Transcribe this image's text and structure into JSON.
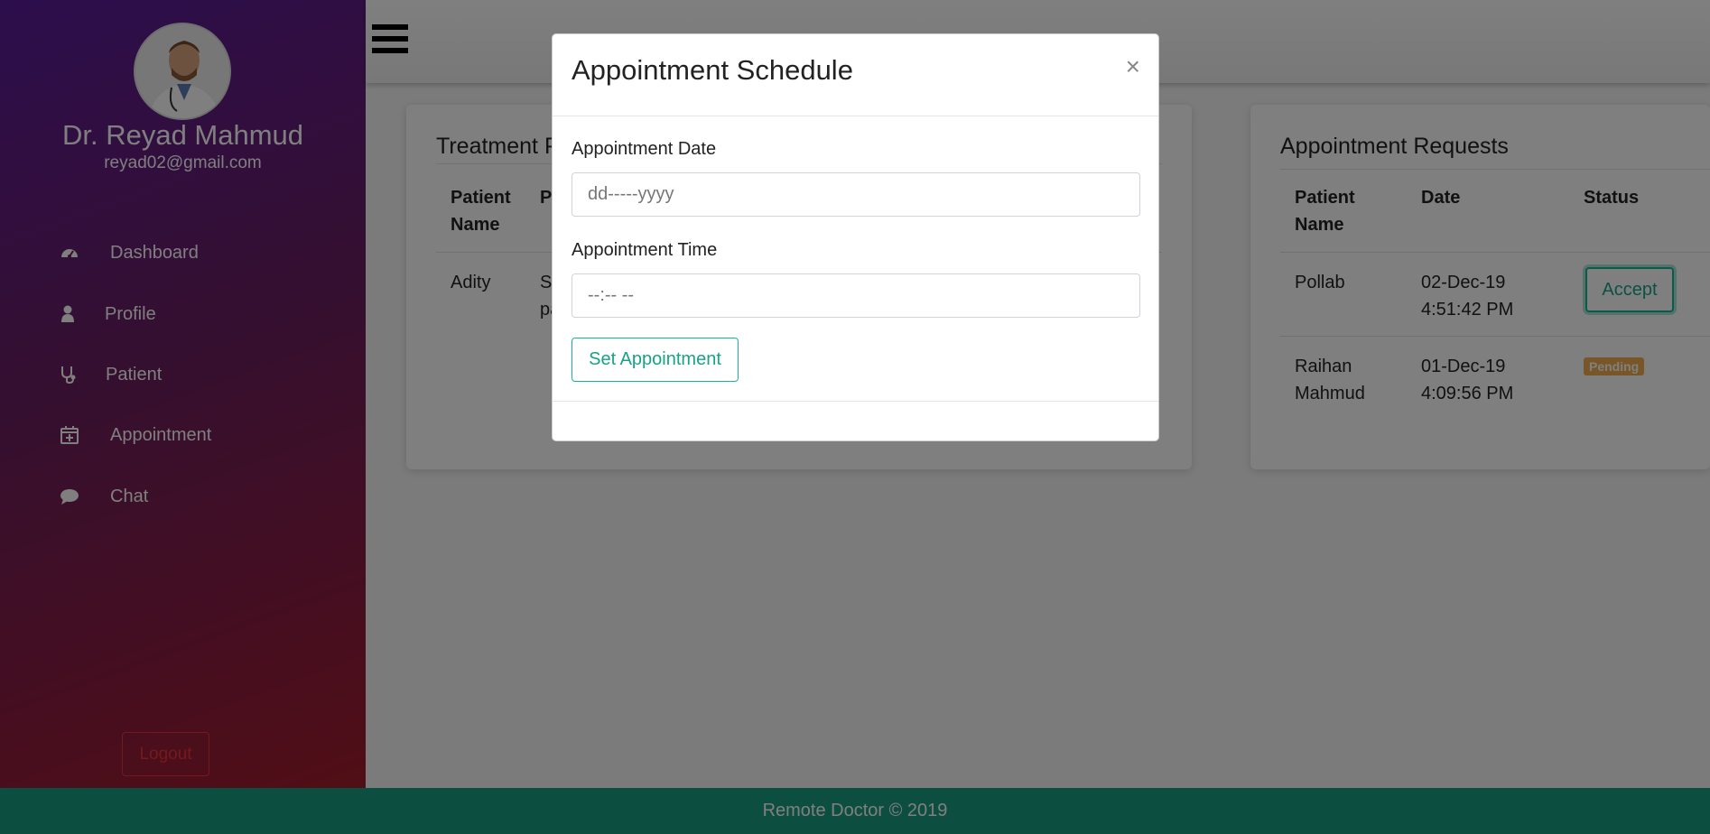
{
  "sidebar": {
    "doctor_name": "Dr. Reyad Mahmud",
    "email": "reyad02@gmail.com",
    "items": [
      {
        "label": "Dashboard",
        "icon": "dashboard-icon"
      },
      {
        "label": "Profile",
        "icon": "user-icon"
      },
      {
        "label": "Patient",
        "icon": "stethoscope-icon"
      },
      {
        "label": "Appointment",
        "icon": "calendar-plus-icon"
      },
      {
        "label": "Chat",
        "icon": "chat-icon"
      }
    ],
    "logout_label": "Logout"
  },
  "treatment_card": {
    "title_visible": "Treatment P",
    "headers": [
      "Patient Name",
      "P"
    ],
    "rows": [
      {
        "patient": "Adity",
        "details": "Sp pa"
      }
    ]
  },
  "requests_card": {
    "title": "Appointment Requests",
    "headers": [
      "Patient Name",
      "Date",
      "Status"
    ],
    "rows": [
      {
        "patient": "Pollab",
        "date": "02-Dec-19",
        "time": "4:51:42 PM",
        "status": "Accept"
      },
      {
        "patient": "Raihan Mahmud",
        "date": "01-Dec-19",
        "time": "4:09:56 PM",
        "status": "Pending"
      }
    ]
  },
  "modal": {
    "title": "Appointment Schedule",
    "close_symbol": "×",
    "date_label": "Appointment Date",
    "date_placeholder": "dd-----yyyy",
    "time_label": "Appointment Time",
    "time_placeholder": "--:-- --",
    "submit_label": "Set Appointment"
  },
  "footer": {
    "text": "Remote Doctor © 2019"
  },
  "colors": {
    "accent": "#18b495",
    "footer_bg": "#189e82",
    "pending_badge": "#f0ad4e",
    "logout": "#e8323c"
  }
}
